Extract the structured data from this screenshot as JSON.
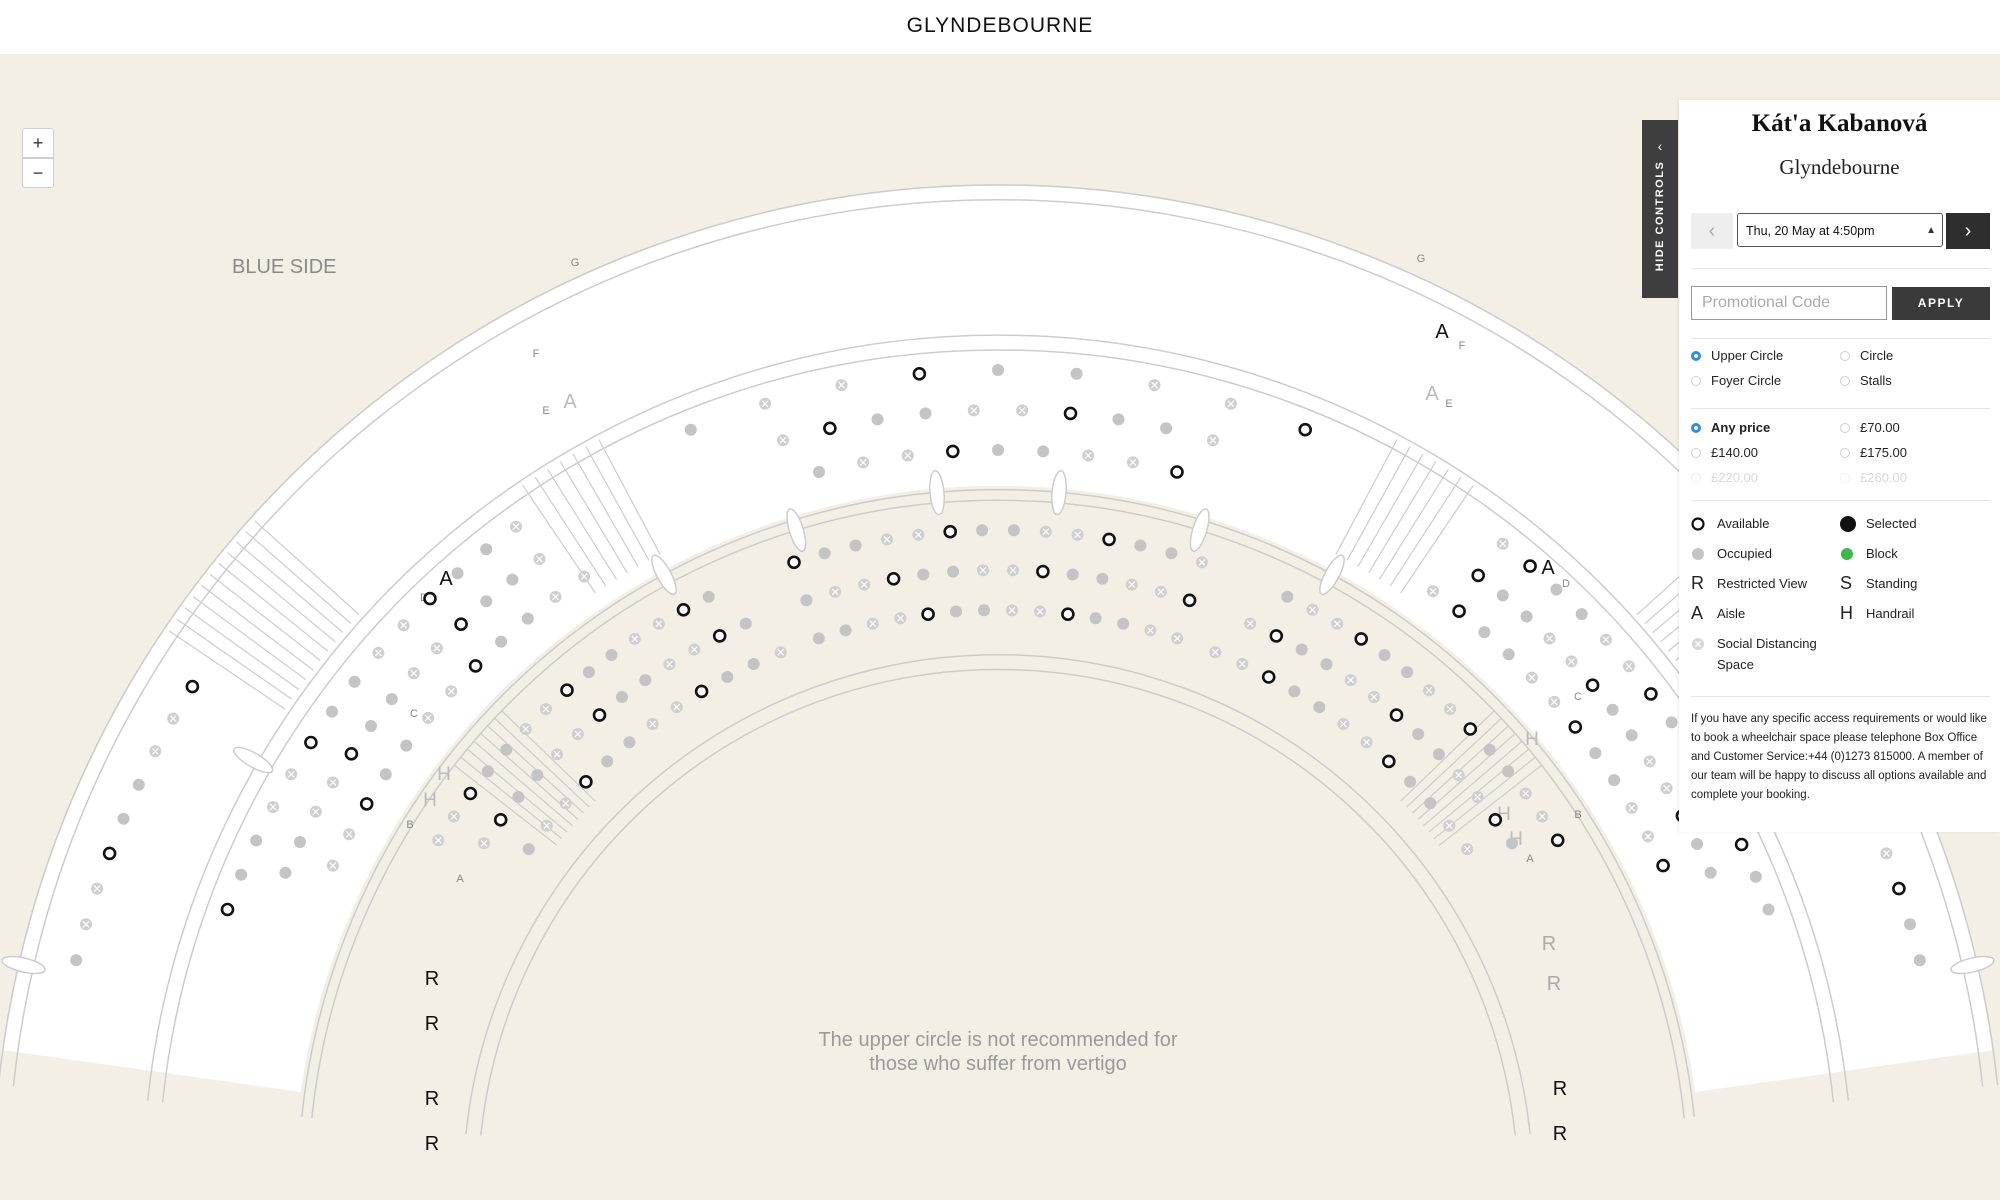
{
  "header": {
    "brand": "GLYNDEBOURNE"
  },
  "map": {
    "zoom_in": "+",
    "zoom_out": "−",
    "side_label": "BLUE SIDE",
    "vertigo_note_line1": "The upper circle is not recommended for",
    "vertigo_note_line2": "those who suffer from vertigo",
    "symbols": {
      "aisle": "A",
      "handrail": "H",
      "restricted": "R"
    },
    "row_letters": [
      "A",
      "B",
      "C",
      "D",
      "E",
      "F",
      "G"
    ],
    "colors": {
      "background": "#f3efe4",
      "available": "#111111",
      "occupied": "#c4c4c4",
      "distancing": "#cfcfcf",
      "outline": "#cccccc"
    }
  },
  "controls": {
    "hide_label": "HIDE CONTROLS",
    "show_title": "Kát'a Kabanová",
    "venue": "Glyndebourne",
    "date_selected": "Thu, 20 May at 4:50pm",
    "promo_placeholder": "Promotional Code",
    "apply_label": "APPLY",
    "areas": [
      {
        "label": "Upper Circle",
        "selected": true
      },
      {
        "label": "Circle",
        "selected": false
      },
      {
        "label": "Foyer Circle",
        "selected": false
      },
      {
        "label": "Stalls",
        "selected": false
      }
    ],
    "prices": [
      {
        "label": "Any price",
        "selected": true,
        "disabled": false
      },
      {
        "label": "£70.00",
        "selected": false,
        "disabled": false
      },
      {
        "label": "£140.00",
        "selected": false,
        "disabled": false
      },
      {
        "label": "£175.00",
        "selected": false,
        "disabled": false
      },
      {
        "label": "£220.00",
        "selected": false,
        "disabled": true
      },
      {
        "label": "£260.00",
        "selected": false,
        "disabled": true
      }
    ],
    "legend": {
      "available": "Available",
      "selected": "Selected",
      "occupied": "Occupied",
      "block": "Block",
      "restricted_view": "Restricted View",
      "standing": "Standing",
      "aisle": "Aisle",
      "handrail": "Handrail",
      "distancing_line1": "Social Distancing",
      "distancing_line2": "Space",
      "sym_r": "R",
      "sym_s": "S",
      "sym_a": "A",
      "sym_h": "H",
      "block_color": "#3cb94a"
    },
    "access_note": "If you have any specific access requirements or would like to book a wheelchair space please telephone Box Office and Customer Service:+44 (0)1273 815000. A member of our team will be happy to discuss all options available and complete your booking."
  }
}
